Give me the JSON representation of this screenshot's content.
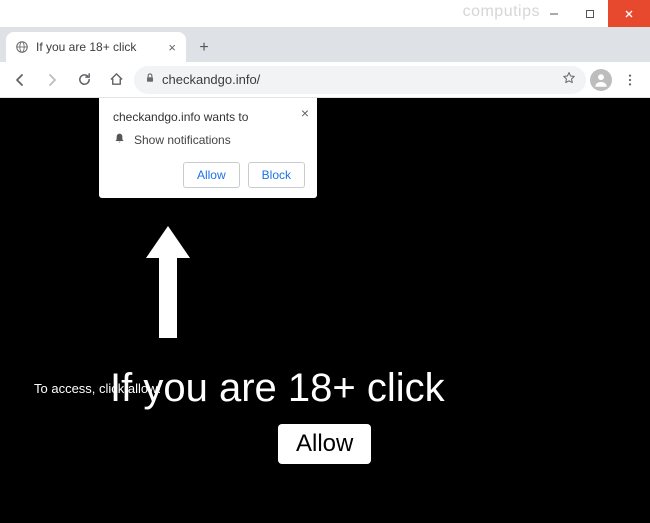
{
  "watermark": "computips",
  "tab": {
    "title": "If you are 18+ click"
  },
  "omnibox": {
    "url": "checkandgo.info/"
  },
  "permission": {
    "origin_line": "checkandgo.info wants to",
    "row_label": "Show notifications",
    "allow": "Allow",
    "block": "Block"
  },
  "page": {
    "headline": "If you are 18+ click",
    "subline": "To access, click allow!",
    "button": "Allow"
  }
}
